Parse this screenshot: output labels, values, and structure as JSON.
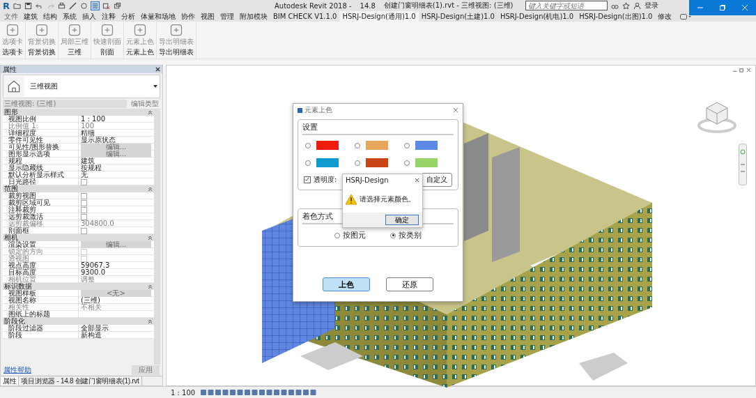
{
  "title_bar": {
    "app_logo": "R",
    "app_title": "Autodesk Revit 2018 -",
    "version": "14.8",
    "document": "创建门窗明细表(1).rvt - 三维视图: (三维)",
    "search": {
      "placeholder": "键入关键字或短语"
    },
    "login": "登录"
  },
  "ribbon_tabs": {
    "file_tab": "文件",
    "tabs": [
      {
        "label": "建筑",
        "selected": false
      },
      {
        "label": "结构",
        "selected": false
      },
      {
        "label": "系统",
        "selected": false
      },
      {
        "label": "插入",
        "selected": false
      },
      {
        "label": "注释",
        "selected": false
      },
      {
        "label": "分析",
        "selected": false
      },
      {
        "label": "体量和场地",
        "selected": false
      },
      {
        "label": "协作",
        "selected": false
      },
      {
        "label": "视图",
        "selected": false
      },
      {
        "label": "管理",
        "selected": false
      },
      {
        "label": "附加模块",
        "selected": false
      },
      {
        "label": "BIM CHECK V1.1.0",
        "selected": false
      },
      {
        "label": "HSRJ-Design(通用)1.0",
        "selected": true
      },
      {
        "label": "HSRJ-Design(土建)1.0",
        "selected": false
      },
      {
        "label": "HSRJ-Design(机电)1.0",
        "selected": false
      },
      {
        "label": "HSRJ-Design(出图)1.0",
        "selected": false
      },
      {
        "label": "修改",
        "selected": false
      }
    ]
  },
  "ribbon_panels": [
    {
      "group": "选项卡",
      "buttons": [
        {
          "label": "选项卡",
          "disabled": true
        }
      ]
    },
    {
      "group": "背景切换",
      "buttons": [
        {
          "label": "背景切换",
          "disabled": true
        }
      ]
    },
    {
      "group": "三维",
      "buttons": [
        {
          "label": "局部三维",
          "disabled": true
        }
      ]
    },
    {
      "group": "剖面",
      "buttons": [
        {
          "label": "快速剖面",
          "disabled": true
        }
      ]
    },
    {
      "group": "元素上色",
      "buttons": [
        {
          "label": "元素上色",
          "disabled": true
        }
      ]
    },
    {
      "group": "导出明细表",
      "buttons": [
        {
          "label": "导出明细表",
          "disabled": true
        }
      ]
    }
  ],
  "properties": {
    "title": "属性",
    "type_name": "三维视图",
    "instance_selector": "三维视图: (三维)",
    "edit_type": "编辑类型",
    "sections": [
      {
        "title": "图形",
        "rows": [
          {
            "name": "视图比例",
            "kind": "text",
            "value": "1 : 100",
            "disabled": false
          },
          {
            "name": "比例值 1:",
            "kind": "text",
            "value": "100",
            "disabled": true
          },
          {
            "name": "详细程度",
            "kind": "text",
            "value": "精细",
            "disabled": false
          },
          {
            "name": "零件可见性",
            "kind": "text",
            "value": "显示原状态",
            "disabled": false
          },
          {
            "name": "可见性/图形替换",
            "kind": "button",
            "value": "编辑...",
            "disabled": false
          },
          {
            "name": "图形显示选项",
            "kind": "button",
            "value": "编辑...",
            "disabled": false
          },
          {
            "name": "规程",
            "kind": "text",
            "value": "建筑",
            "disabled": false
          },
          {
            "name": "显示隐藏线",
            "kind": "text",
            "value": "按规程",
            "disabled": false
          },
          {
            "name": "默认分析显示样式",
            "kind": "text",
            "value": "无",
            "disabled": false
          },
          {
            "name": "日光路径",
            "kind": "check",
            "checked": false,
            "disabled": false
          }
        ]
      },
      {
        "title": "范围",
        "rows": [
          {
            "name": "裁剪视图",
            "kind": "check",
            "checked": false,
            "disabled": false
          },
          {
            "name": "裁剪区域可见",
            "kind": "check",
            "checked": false,
            "disabled": false
          },
          {
            "name": "注释裁剪",
            "kind": "check",
            "checked": false,
            "disabled": false
          },
          {
            "name": "远剪裁激活",
            "kind": "check",
            "checked": false,
            "disabled": false
          },
          {
            "name": "远剪裁偏移",
            "kind": "text",
            "value": "304800.0",
            "disabled": true
          },
          {
            "name": "剖面框",
            "kind": "check",
            "checked": false,
            "disabled": false
          }
        ]
      },
      {
        "title": "相机",
        "rows": [
          {
            "name": "渲染设置",
            "kind": "button",
            "value": "编辑...",
            "disabled": false
          },
          {
            "name": "锁定的方向",
            "kind": "check",
            "checked": false,
            "disabled": true
          },
          {
            "name": "透视图",
            "kind": "check",
            "checked": false,
            "disabled": true
          },
          {
            "name": "视点高度",
            "kind": "text",
            "value": "59067.3",
            "disabled": false
          },
          {
            "name": "目标高度",
            "kind": "text",
            "value": "9300.0",
            "disabled": false
          },
          {
            "name": "相机位置",
            "kind": "text",
            "value": "调整",
            "disabled": true
          }
        ]
      },
      {
        "title": "标识数据",
        "rows": [
          {
            "name": "视图样板",
            "kind": "button",
            "value": "<无>",
            "disabled": false
          },
          {
            "name": "视图名称",
            "kind": "text",
            "value": "(三维)",
            "disabled": false
          },
          {
            "name": "相关性",
            "kind": "text",
            "value": "不相关",
            "disabled": true
          },
          {
            "name": "图纸上的标题",
            "kind": "text",
            "disabled": false
          }
        ]
      },
      {
        "title": "阶段化",
        "rows": [
          {
            "name": "阶段过滤器",
            "kind": "text",
            "value": "全部显示",
            "disabled": false
          },
          {
            "name": "阶段",
            "kind": "text",
            "value": "新构造",
            "disabled": false
          }
        ]
      }
    ],
    "help_link": "属性帮助",
    "apply": {
      "label": "应用",
      "disabled": true
    },
    "bottom_tabs": [
      {
        "label": "属性",
        "selected": true
      },
      {
        "label": "项目浏览器 - 14.8  创建门窗明细表(1).rvt",
        "selected": false
      }
    ]
  },
  "dialog": {
    "title": "元素上色",
    "settings_title": "设置",
    "colors": [
      {
        "color": "#f21c0e",
        "selected": false
      },
      {
        "color": "#e8a55c",
        "selected": false
      },
      {
        "color": "#5d8ae6",
        "selected": false
      },
      {
        "color": "#0e9bd0",
        "selected": false
      },
      {
        "color": "#c94416",
        "selected": false
      },
      {
        "color": "#97d468",
        "selected": false
      }
    ],
    "transparency": {
      "label": "透明度:",
      "checked": true
    },
    "custom_button": "自定义",
    "mode_title": "着色方式",
    "modes": [
      {
        "label": "按图元",
        "selected": false
      },
      {
        "label": "按类别",
        "selected": true
      }
    ],
    "buttons": [
      {
        "label": "上色",
        "kind": "primary"
      },
      {
        "label": "还原",
        "kind": "normal"
      }
    ]
  },
  "alert": {
    "title": "HSRJ-Design",
    "message": "请选择元素颜色。",
    "button": "确定"
  },
  "status_bar": {
    "scale": "1 : 100"
  }
}
